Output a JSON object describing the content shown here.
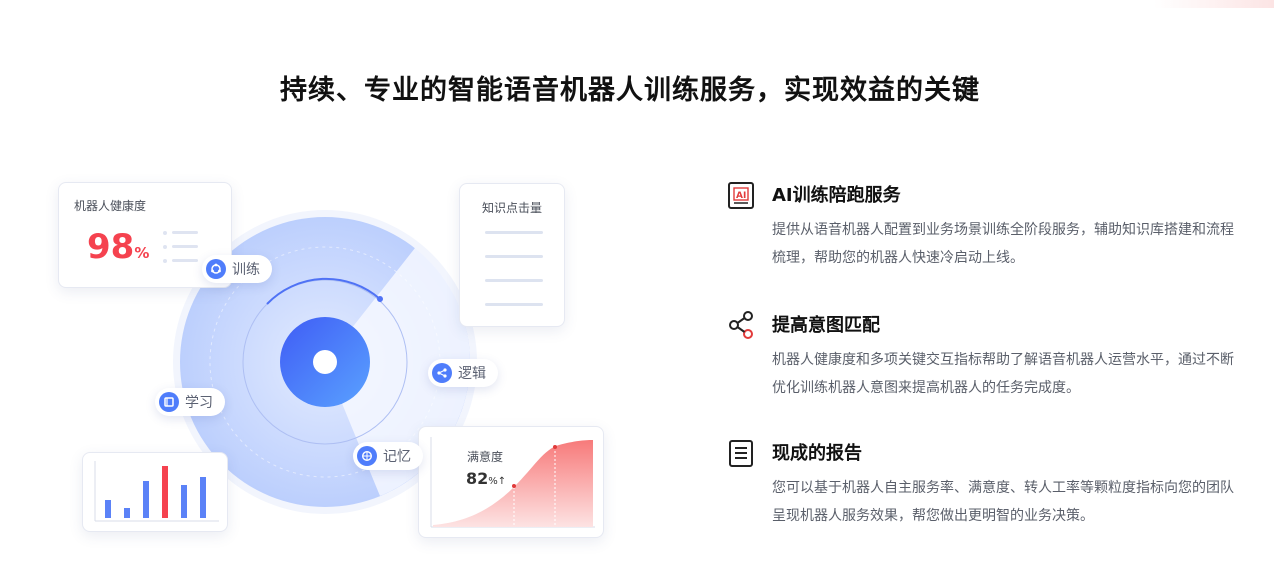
{
  "page": {
    "title": "持续、专业的智能语音机器人训练服务，实现效益的关键"
  },
  "illustration": {
    "health_card": {
      "label": "机器人健康度",
      "value": "98",
      "unit": "%"
    },
    "knowledge_card": {
      "label": "知识点击量"
    },
    "satisfaction_card": {
      "label": "满意度",
      "value": "82",
      "unit": "%"
    },
    "pills": {
      "train": "训练",
      "learn": "学习",
      "logic": "逻辑",
      "memory": "记忆"
    },
    "colors": {
      "accent": "#4f7dfb",
      "red": "#f5424f",
      "radar_light": "#c9d8ff"
    }
  },
  "features": [
    {
      "icon": "ai-document-icon",
      "title": "AI训练陪跑服务",
      "desc": "提供从语音机器人配置到业务场景训练全阶段服务，辅助知识库搭建和流程梳理，帮助您的机器人快速冷启动上线。"
    },
    {
      "icon": "share-nodes-icon",
      "title": "提高意图匹配",
      "desc": "机器人健康度和多项关键交互指标帮助了解语音机器人运营水平，通过不断优化训练机器人意图来提高机器人的任务完成度。"
    },
    {
      "icon": "report-icon",
      "title": "现成的报告",
      "desc": "您可以基于机器人自主服务率、满意度、转人工率等颗粒度指标向您的团队呈现机器人服务效果，帮您做出更明智的业务决策。"
    }
  ]
}
